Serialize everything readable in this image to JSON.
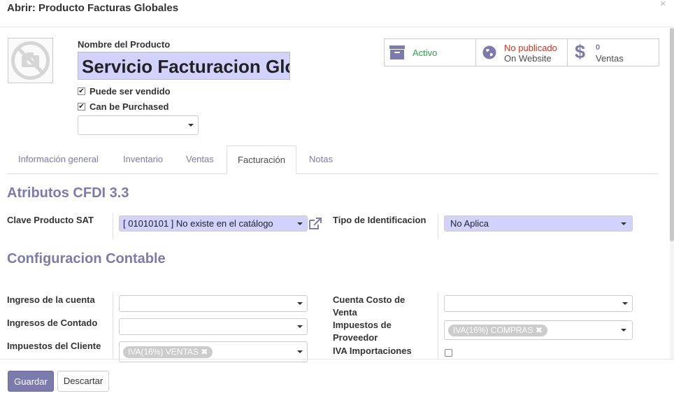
{
  "dialog": {
    "title": "Abrir: Producto Facturas Globales",
    "close_glyph": "×"
  },
  "product": {
    "name_label": "Nombre del Producto",
    "name_value": "Servicio Facturacion Global",
    "can_be_sold_label": "Puede ser vendido",
    "can_be_sold": true,
    "can_be_purchased_label": "Can be Purchased",
    "can_be_purchased": true
  },
  "stat_buttons": {
    "active": {
      "label": "Activo",
      "icon": "archive-icon"
    },
    "website": {
      "line1": "No publicado",
      "line2": "On Website",
      "icon": "globe-icon"
    },
    "sales": {
      "count": "0",
      "label": "Ventas",
      "icon": "dollar-icon"
    }
  },
  "tabs": [
    "Información general",
    "Inventario",
    "Ventas",
    "Facturación",
    "Notas"
  ],
  "active_tab": "Facturación",
  "cfdi": {
    "section_title": "Atributos CFDI 3.3",
    "clave_label": "Clave Producto SAT",
    "clave_value": "[ 01010101 ] No existe en el catálogo",
    "tipo_label": "Tipo de Identificacion",
    "tipo_value": "No Aplica"
  },
  "accounting": {
    "section_title": "Configuracion Contable",
    "ingreso_cuenta_label": "Ingreso de la cuenta",
    "ingresos_contado_label": "Ingresos de Contado",
    "impuestos_cliente_label": "Impuestos del Cliente",
    "impuestos_cliente_tag": "IVA(16%) VENTAS",
    "cuenta_costo_label_1": "Cuenta Costo de",
    "cuenta_costo_label_2": "Venta",
    "impuestos_proveedor_label_1": "Impuestos de",
    "impuestos_proveedor_label_2": "Proveedor",
    "impuestos_proveedor_tag": "IVA(16%) COMPRAS",
    "iva_importaciones_label": "IVA Importaciones",
    "iva_importaciones": false,
    "tag_remove_glyph": "✖"
  },
  "footer": {
    "save_label": "Guardar",
    "discard_label": "Descartar"
  },
  "colors": {
    "primary": "#7c7bad",
    "required_field": "#d2d2ff",
    "active_green": "#28a745",
    "unpublished_red": "#c0392b"
  }
}
